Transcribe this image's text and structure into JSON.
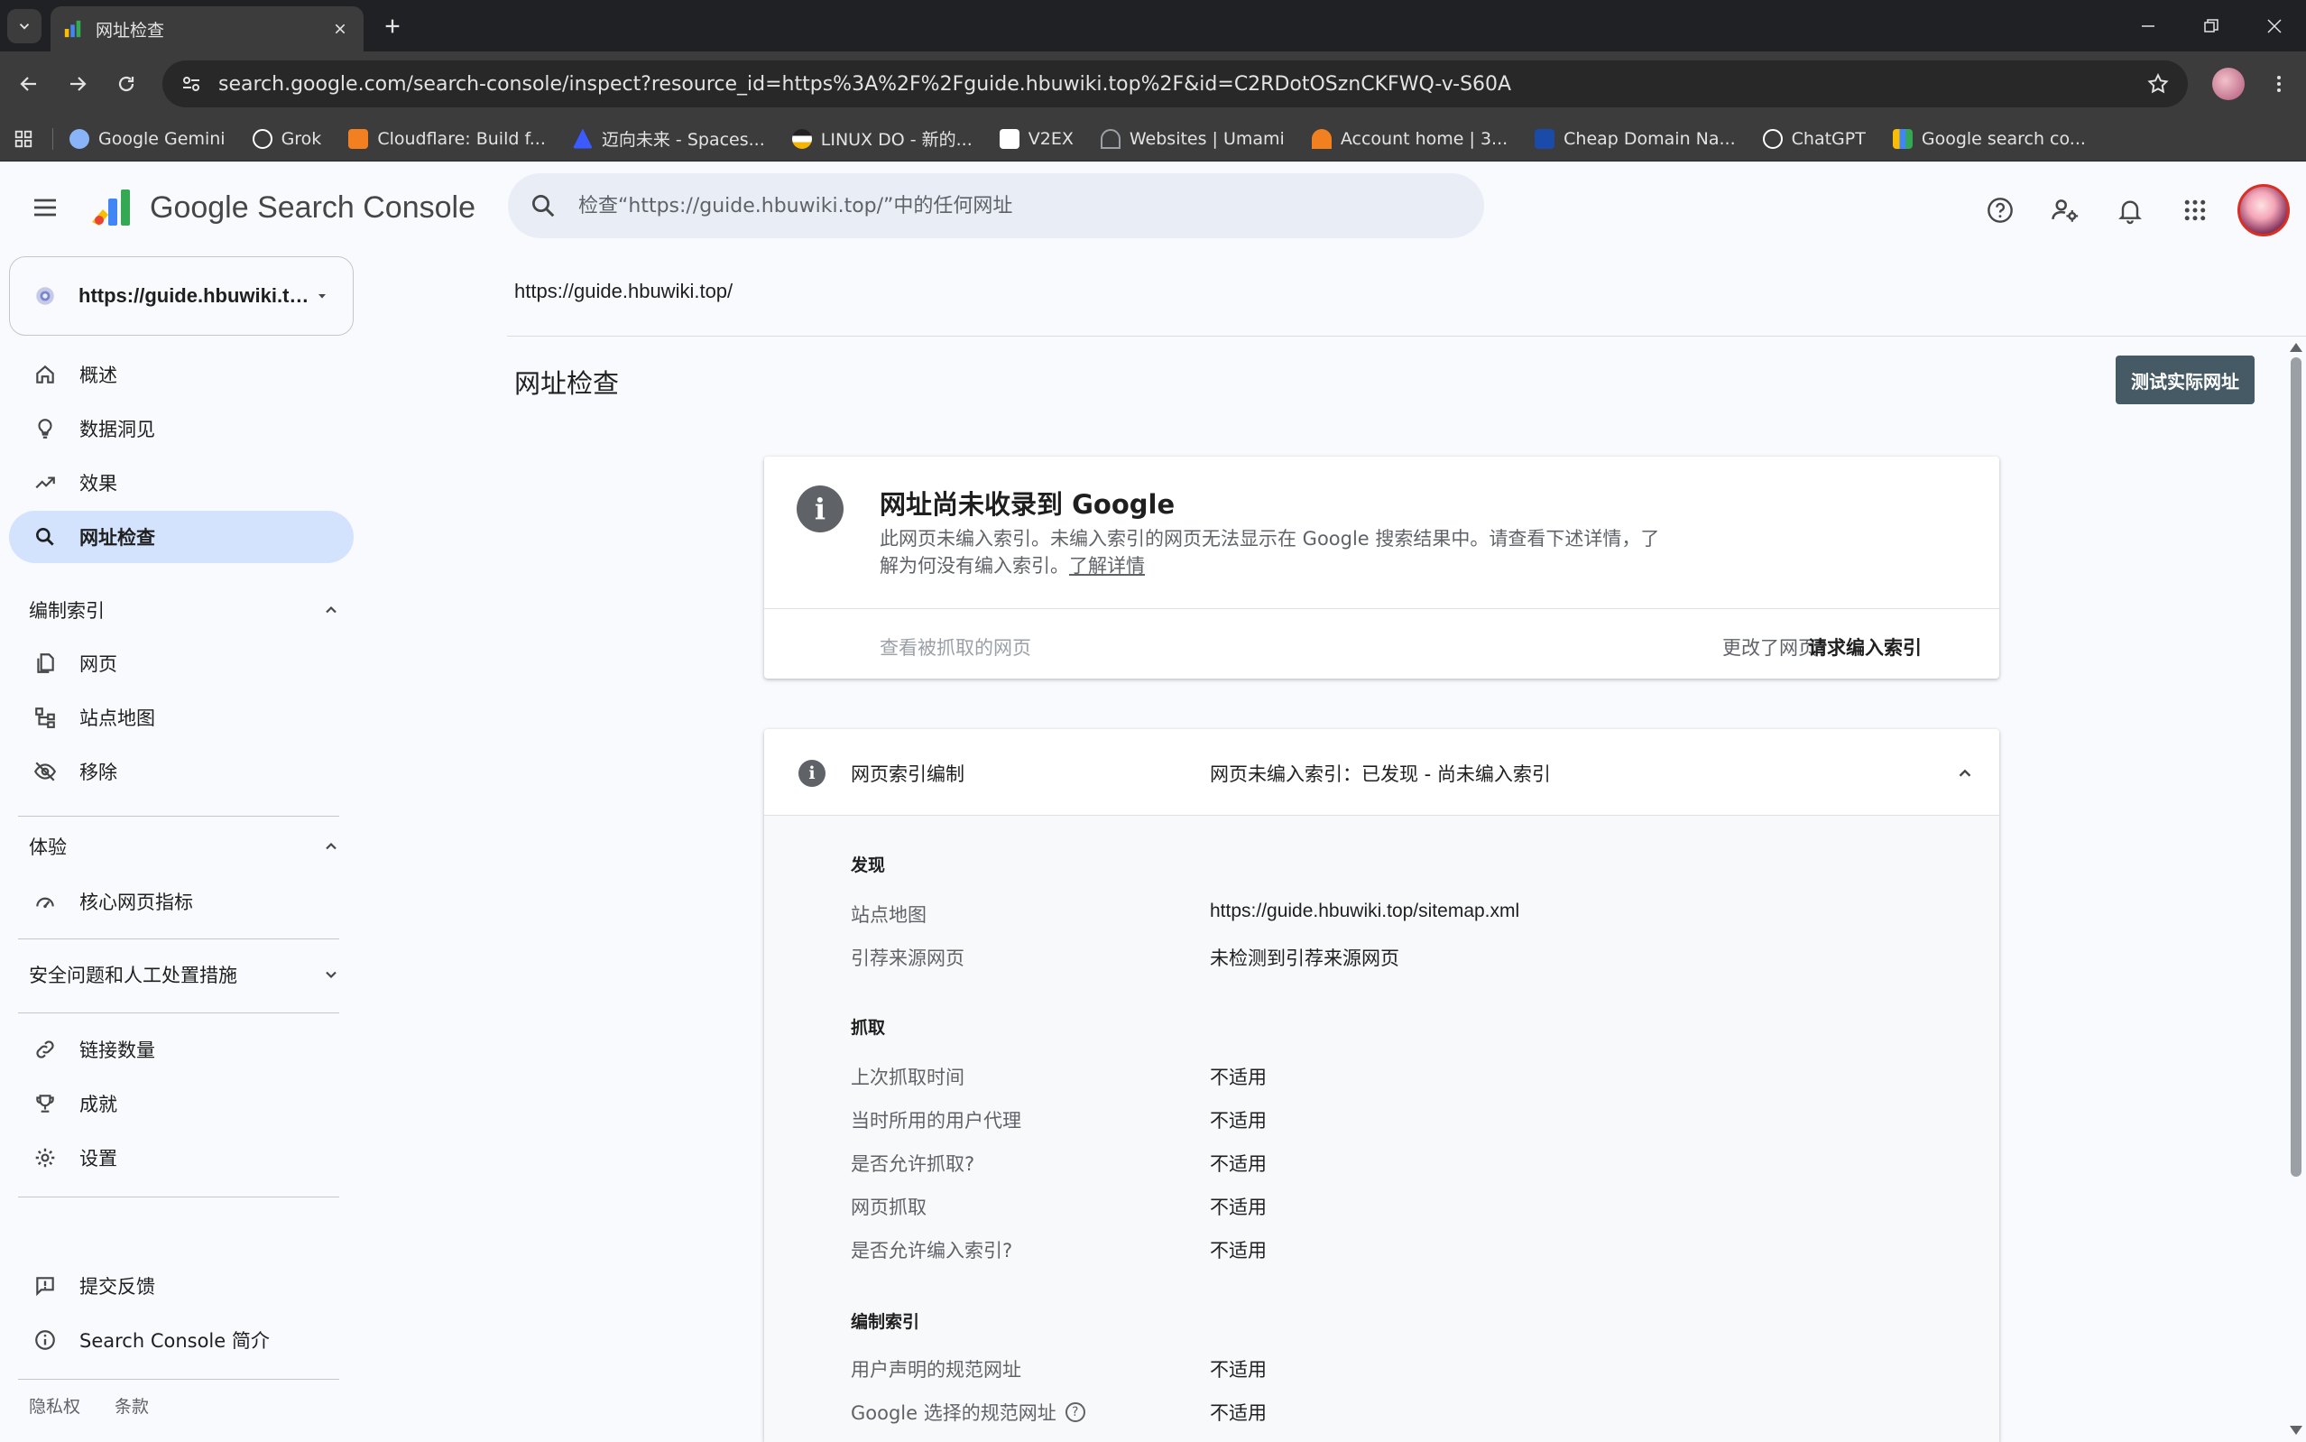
{
  "browser": {
    "tab_title": "网址检查",
    "url": "search.google.com/search-console/inspect?resource_id=https%3A%2F%2Fguide.hbuwiki.top%2F&id=C2RDotOSznCKFWQ-v-S60A",
    "bookmarks": [
      {
        "label": "Google Gemini",
        "icon": "gemini-icon",
        "color": "#8ab4f8"
      },
      {
        "label": "Grok",
        "icon": "grok-icon",
        "color": "#ffffff"
      },
      {
        "label": "Cloudflare: Build f...",
        "icon": "cloudflare-icon",
        "color": "#f38020"
      },
      {
        "label": "迈向未来 - Spaces...",
        "icon": "spaces-icon",
        "color": "#3b5bff"
      },
      {
        "label": "LINUX DO - 新的...",
        "icon": "linuxdo-icon",
        "color": "#f4b400"
      },
      {
        "label": "V2EX",
        "icon": "v2ex-icon",
        "color": "#ffffff"
      },
      {
        "label": "Websites | Umami",
        "icon": "umami-icon",
        "color": "#9aa0a6"
      },
      {
        "label": "Account home | 3...",
        "icon": "account-icon",
        "color": "#f38020"
      },
      {
        "label": "Cheap Domain Na...",
        "icon": "domain-icon",
        "color": "#1a4ba8"
      },
      {
        "label": "ChatGPT",
        "icon": "chatgpt-icon",
        "color": "#ffffff"
      },
      {
        "label": "Google search co...",
        "icon": "gsc-icon",
        "color": "#4285f4"
      }
    ]
  },
  "header": {
    "logo_text": "Google Search Console",
    "search_placeholder": "检查“https://guide.hbuwiki.top/”中的任何网址"
  },
  "sidebar": {
    "property": "https://guide.hbuwiki.top/",
    "items": [
      {
        "label": "概述",
        "icon": "home-icon"
      },
      {
        "label": "数据洞见",
        "icon": "lightbulb-icon"
      },
      {
        "label": "效果",
        "icon": "trending-up-icon"
      },
      {
        "label": "网址检查",
        "icon": "search-icon"
      }
    ],
    "section_indexing": "编制索引",
    "indexing_items": [
      {
        "label": "网页",
        "icon": "pages-icon"
      },
      {
        "label": "站点地图",
        "icon": "sitemap-icon"
      },
      {
        "label": "移除",
        "icon": "removals-icon"
      }
    ],
    "section_experience": "体验",
    "experience_items": [
      {
        "label": "核心网页指标",
        "icon": "speed-icon"
      }
    ],
    "section_security": "安全问题和人工处置措施",
    "other_items": [
      {
        "label": "链接数量",
        "icon": "link-icon"
      },
      {
        "label": "成就",
        "icon": "trophy-icon"
      },
      {
        "label": "设置",
        "icon": "settings-icon"
      }
    ],
    "bottom_items": [
      {
        "label": "提交反馈",
        "icon": "feedback-icon"
      },
      {
        "label": "Search Console 简介",
        "icon": "info-icon"
      }
    ],
    "footer": {
      "privacy": "隐私权",
      "terms": "条款"
    }
  },
  "main": {
    "inspected_url": "https://guide.hbuwiki.top/",
    "page_title": "网址检查",
    "test_live_label": "测试实际网址",
    "status": {
      "title": "网址尚未收录到 Google",
      "desc": "此网页未编入索引。未编入索引的网页无法显示在 Google 搜索结果中。请查看下述详情，了解为何没有编入索引。",
      "learn_more": "了解详情",
      "view_crawled": "查看被抓取的网页",
      "changed_q": "更改了网页?",
      "request_index": "请求编入索引"
    },
    "index": {
      "label": "网页索引编制",
      "value": "网页未编入索引：已发现 - 尚未编入索引",
      "discovery_title": "发现",
      "sitemap_label": "站点地图",
      "sitemap_value": "https://guide.hbuwiki.top/sitemap.xml",
      "referring_label": "引荐来源网页",
      "referring_value": "未检测到引荐来源网页",
      "crawl_title": "抓取",
      "last_crawl_label": "上次抓取时间",
      "user_agent_label": "当时所用的用户代理",
      "crawl_allowed_label": "是否允许抓取?",
      "page_fetch_label": "网页抓取",
      "index_allowed_label": "是否允许编入索引?",
      "indexing_title": "编制索引",
      "user_canonical_label": "用户声明的规范网址",
      "google_canonical_label": "Google 选择的规范网址",
      "na": "不适用"
    }
  }
}
